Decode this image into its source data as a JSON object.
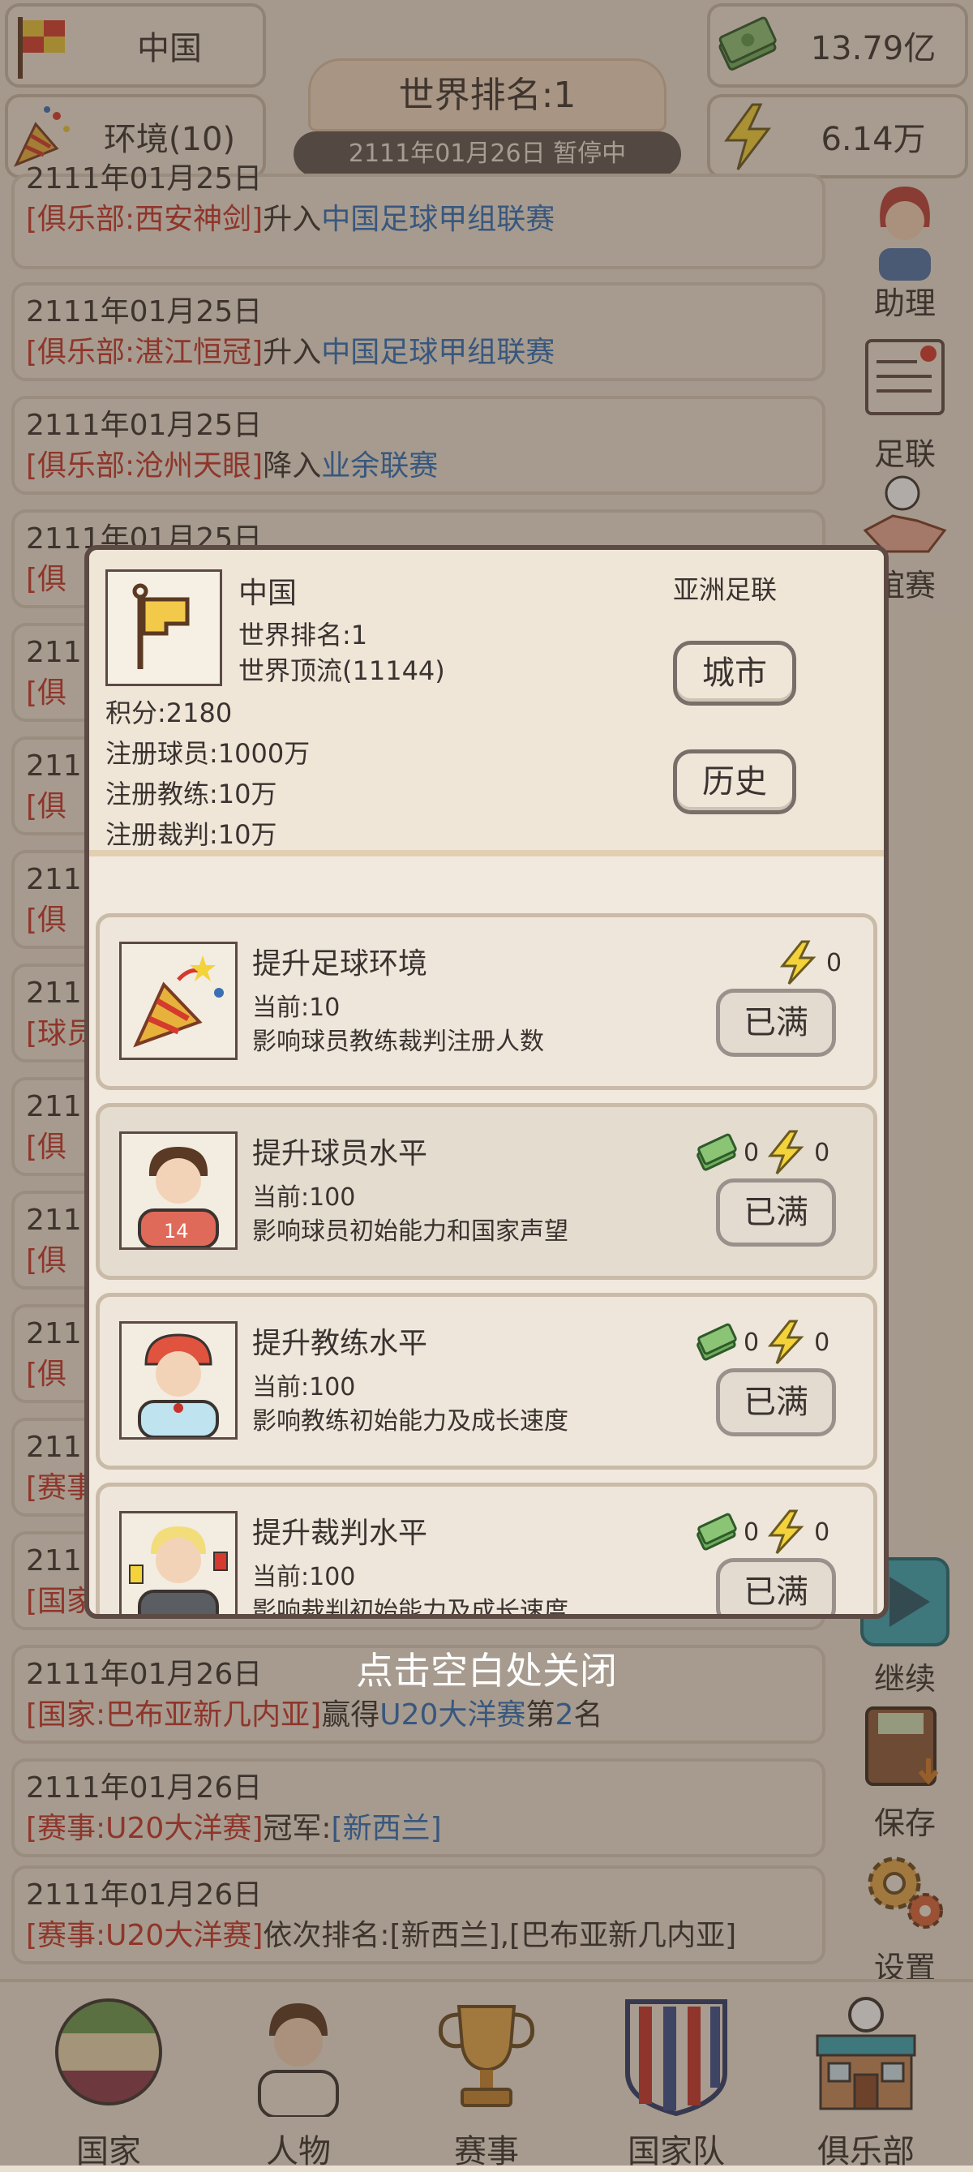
{
  "topbar": {
    "country": "中国",
    "environment": "环境(10)",
    "money": "13.79亿",
    "energy": "6.14万",
    "title": "世界排名:1",
    "subtitle": "2111年01月26日 暂停中"
  },
  "news": [
    {
      "date": "2111年01月25日",
      "tag": "[俱乐部:西安神剑]",
      "verb": "升入",
      "target": "中国足球甲组联赛"
    },
    {
      "date": "2111年01月25日",
      "tag": "[俱乐部:湛江恒冠]",
      "verb": "升入",
      "target": "中国足球甲组联赛"
    },
    {
      "date": "2111年01月25日",
      "tag": "[俱乐部:沧州天眼]",
      "verb": "降入",
      "target": "业余联赛"
    },
    {
      "date": "2111年01月25日",
      "tag": "[俱",
      "verb": "",
      "target": ""
    },
    {
      "date": "2111",
      "tag": "[俱",
      "verb": "",
      "target": ""
    },
    {
      "date": "2111",
      "tag": "[俱",
      "verb": "",
      "target": ""
    },
    {
      "date": "2111",
      "tag": "[俱",
      "verb": "",
      "target": ""
    },
    {
      "date": "2111",
      "tag": "[球员",
      "verb": "",
      "target": ""
    },
    {
      "date": "2111",
      "tag": "[俱",
      "verb": "",
      "target": ""
    },
    {
      "date": "2111",
      "tag": "[俱",
      "verb": "",
      "target": ""
    },
    {
      "date": "2111",
      "tag": "[俱",
      "verb": "",
      "target": ""
    },
    {
      "date": "2111",
      "tag": "[赛事",
      "verb": "",
      "target": ""
    },
    {
      "date": "2111",
      "tag": "[国家",
      "verb": "",
      "target": ""
    }
  ],
  "news_bottom": [
    {
      "date": "2111年01月26日",
      "tag": "[国家:巴布亚新几内亚]",
      "verb": "赢得",
      "target": "U20大洋赛",
      "tail_a": "第",
      "num": "2",
      "tail_b": "名"
    },
    {
      "date": "2111年01月26日",
      "tag": "[赛事:U20大洋赛]",
      "verb": "冠军:",
      "target": "[新西兰]",
      "tail_a": "",
      "num": "",
      "tail_b": ""
    },
    {
      "date": "2111年01月26日",
      "tag": "[赛事:U20大洋赛]",
      "verb": "依次排名:[新西兰],[巴布亚新几内亚]",
      "target": "",
      "tail_a": "",
      "num": "",
      "tail_b": ""
    }
  ],
  "side": {
    "assistant": "助理",
    "fa": "足联",
    "friendly": "谊赛",
    "continue": "继续",
    "save": "保存",
    "settings": "设置"
  },
  "nav": [
    "国家",
    "人物",
    "赛事",
    "国家队",
    "俱乐部"
  ],
  "dialog": {
    "name": "中国",
    "confed": "亚洲足联",
    "rank": "世界排名:1",
    "tier": "世界顶流(11144)",
    "points": "积分:2180",
    "players": "注册球员:1000万",
    "coaches": "注册教练:10万",
    "referees": "注册裁判:10万",
    "city_button": "城市",
    "history_button": "历史",
    "upgrades": [
      {
        "title": "提升足球环境",
        "current": "当前:10",
        "desc": "影响球员教练裁判注册人数",
        "money": "",
        "energy": "0",
        "button": "已满"
      },
      {
        "title": "提升球员水平",
        "current": "当前:100",
        "desc": "影响球员初始能力和国家声望",
        "money": "0",
        "energy": "0",
        "button": "已满"
      },
      {
        "title": "提升教练水平",
        "current": "当前:100",
        "desc": "影响教练初始能力及成长速度",
        "money": "0",
        "energy": "0",
        "button": "已满"
      },
      {
        "title": "提升裁判水平",
        "current": "当前:100",
        "desc": "影响裁判初始能力及成长速度",
        "money": "0",
        "energy": "0",
        "button": "已满"
      }
    ]
  },
  "hint": "点击空白处关闭",
  "colors": {
    "red": "#c4342a",
    "blue": "#2f6fb9",
    "overlay": "rgba(70,55,45,0.42)"
  }
}
